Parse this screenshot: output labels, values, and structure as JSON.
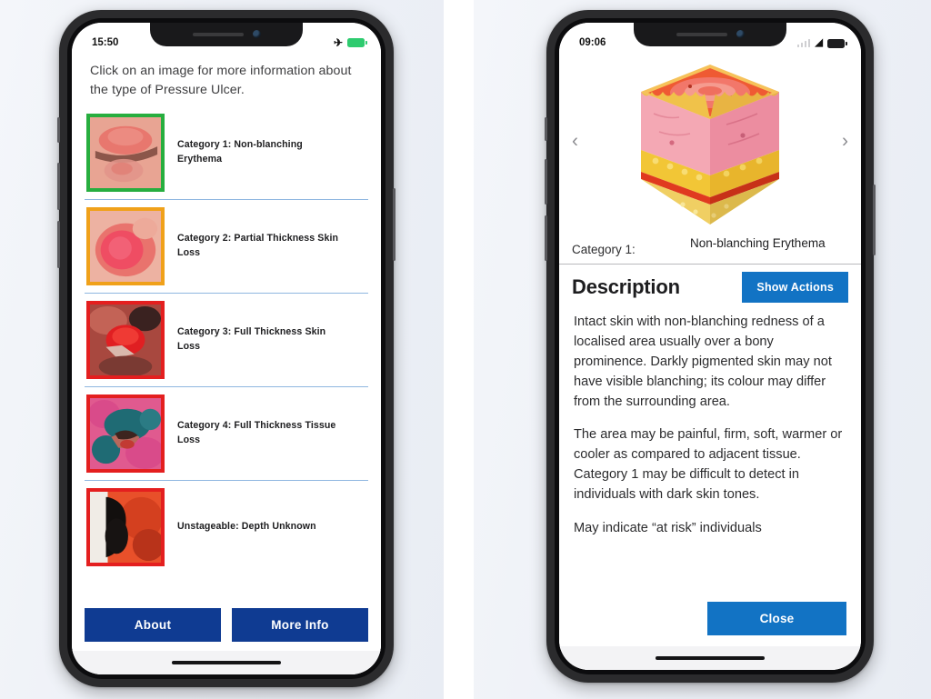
{
  "panels": {
    "left": {
      "status": {
        "time": "15:50",
        "airplane_icon": "airplane-icon",
        "battery_icon": "battery-full-icon"
      },
      "intro": "Click on an image for more information about the type of Pressure Ulcer.",
      "items": [
        {
          "label": "Category 1: Non-blanching Erythema",
          "border_color": "#27ae3f",
          "thumb": "pressure-ulcer-category-1"
        },
        {
          "label": "Category 2: Partial Thickness Skin Loss",
          "border_color": "#f0a11a",
          "thumb": "pressure-ulcer-category-2"
        },
        {
          "label": "Category 3: Full Thickness Skin Loss",
          "border_color": "#e41f1f",
          "thumb": "pressure-ulcer-category-3"
        },
        {
          "label": "Category 4: Full Thickness Tissue Loss",
          "border_color": "#e41f1f",
          "thumb": "pressure-ulcer-category-4"
        },
        {
          "label": "Unstageable: Depth Unknown",
          "border_color": "#e41f1f",
          "thumb": "pressure-ulcer-unstageable"
        }
      ],
      "buttons": {
        "about": "About",
        "more_info": "More Info"
      }
    },
    "right": {
      "status": {
        "time": "09:06",
        "signal_icon": "signal-bars-icon",
        "wifi_icon": "wifi-icon",
        "battery_icon": "battery-icon"
      },
      "carousel": {
        "prev": "‹",
        "next": "›",
        "image_name": "skin-cross-section-diagram"
      },
      "category_key": "Category 1:",
      "category_value": "Non-blanching Erythema",
      "description_title": "Description",
      "show_actions": "Show Actions",
      "paragraphs": [
        "Intact skin with non-blanching redness of a localised area usually over a bony prominence. Darkly pigmented skin may not have visible blanching; its colour may differ from the surrounding area.",
        "The area may be painful, firm, soft, warmer or cooler as compared to adjacent tissue. Category 1 may be difficult to detect in individuals with dark skin tones.",
        "May indicate “at risk” individuals"
      ],
      "close": "Close"
    }
  },
  "colors": {
    "navy_button": "#0f3b92",
    "blue_button": "#1273c4",
    "divider": "#8fb6e0",
    "battery_green": "#2ecb6f"
  }
}
